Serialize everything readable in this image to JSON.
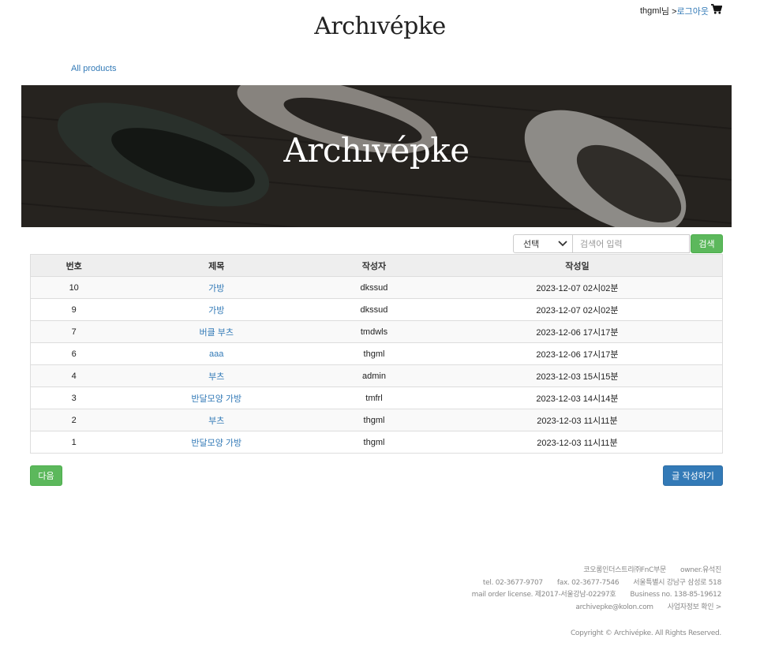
{
  "header": {
    "logo": "Archıvépke",
    "user_name": "thgml",
    "user_suffix": "님 >",
    "logout_label": "로그아웃"
  },
  "nav": {
    "all_products": "All products"
  },
  "banner": {
    "title": "Archıvépke"
  },
  "search": {
    "select_value": "선택",
    "placeholder": "검색어 입력",
    "button_label": "검색"
  },
  "table": {
    "headers": {
      "no": "번호",
      "title": "제목",
      "writer": "작성자",
      "date": "작성일"
    },
    "rows": [
      {
        "no": "10",
        "title": "가방",
        "writer": "dkssud",
        "date": "2023-12-07 02시02분"
      },
      {
        "no": "9",
        "title": "가방",
        "writer": "dkssud",
        "date": "2023-12-07 02시02분"
      },
      {
        "no": "7",
        "title": "버클 부츠",
        "writer": "tmdwls",
        "date": "2023-12-06 17시17분"
      },
      {
        "no": "6",
        "title": "aaa",
        "writer": "thgml",
        "date": "2023-12-06 17시17분"
      },
      {
        "no": "4",
        "title": "부츠",
        "writer": "admin",
        "date": "2023-12-03 15시15분"
      },
      {
        "no": "3",
        "title": "반달모양 가방",
        "writer": "tmfrl",
        "date": "2023-12-03 14시14분"
      },
      {
        "no": "2",
        "title": "부츠",
        "writer": "thgml",
        "date": "2023-12-03 11시11분"
      },
      {
        "no": "1",
        "title": "반달모양 가방",
        "writer": "thgml",
        "date": "2023-12-03 11시11분"
      }
    ]
  },
  "buttons": {
    "next": "다음",
    "write": "글 작성하기"
  },
  "footer": {
    "company": "코오롱인더스트리㈜FnC부문",
    "owner": "owner.유석진",
    "tel": "tel. 02-3677-9707",
    "fax": "fax. 02-3677-7546",
    "address": "서울특별시 강남구 삼성로 518",
    "license": "mail order license. 제2017-서울강남-02297호",
    "business_no": "Business no. 138-85-19612",
    "email": "archivepke@kolon.com",
    "business_info": "사업자정보 확인 >",
    "copyright": "Copyright © Archivépke. All Rights Reserved."
  },
  "colors": {
    "link": "#337ab7",
    "success": "#5cb85c",
    "primary": "#337ab7"
  },
  "icons": {
    "cart": "cart-icon",
    "chevron": "chevron-down-icon"
  }
}
